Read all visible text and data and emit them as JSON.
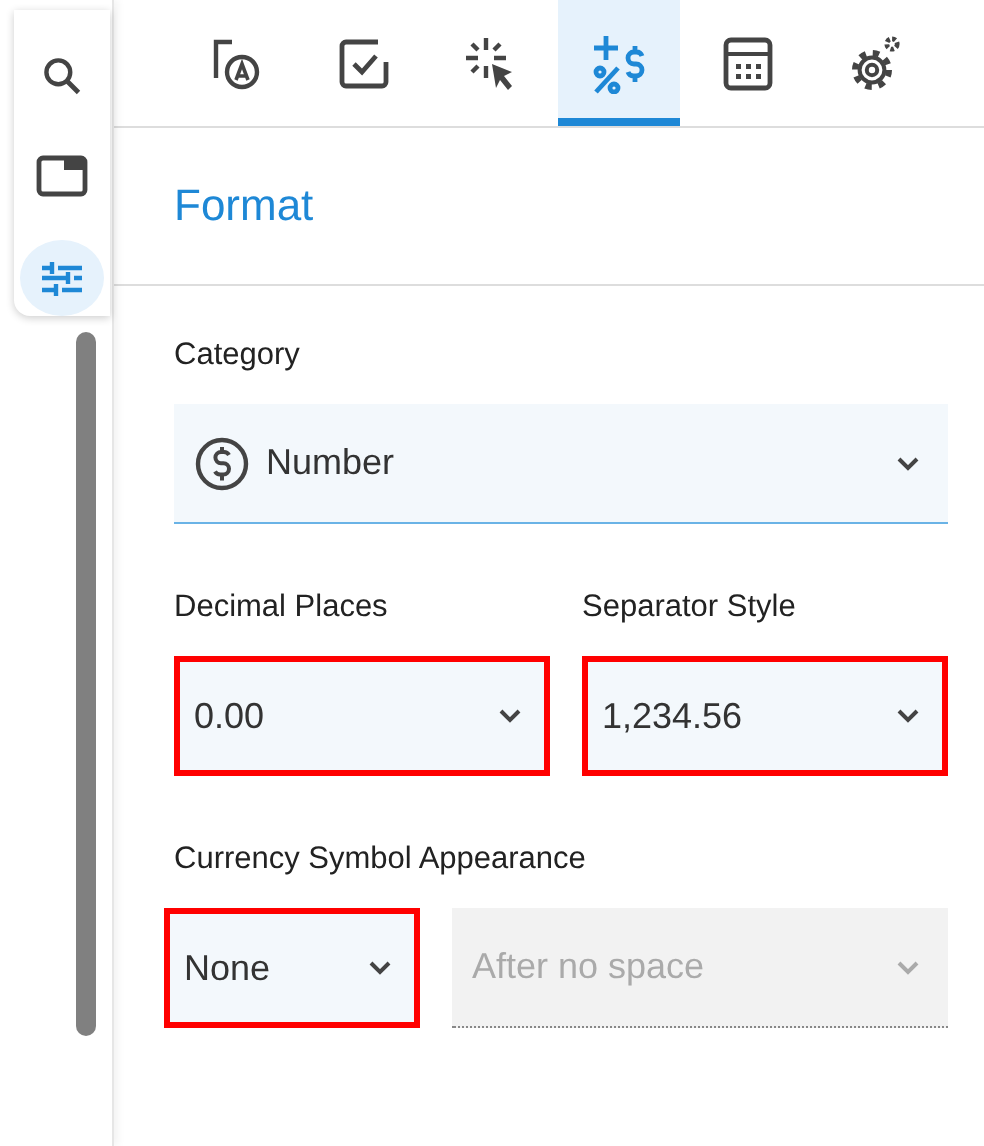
{
  "rail": [
    {
      "kind": "search",
      "selected": false
    },
    {
      "kind": "panel",
      "selected": false
    },
    {
      "kind": "sliders",
      "selected": true
    }
  ],
  "tabs": [
    {
      "kind": "text-style",
      "selected": false
    },
    {
      "kind": "checkbox",
      "selected": false
    },
    {
      "kind": "click",
      "selected": false
    },
    {
      "kind": "format",
      "selected": true
    },
    {
      "kind": "calculator",
      "selected": false
    },
    {
      "kind": "settings",
      "selected": false
    }
  ],
  "title": "Format",
  "category": {
    "label": "Category",
    "value": "Number"
  },
  "decimal_places": {
    "label": "Decimal Places",
    "value": "0.00",
    "highlighted": true
  },
  "separator_style": {
    "label": "Separator Style",
    "value": "1,234.56",
    "highlighted": true
  },
  "currency": {
    "label": "Currency Symbol Appearance",
    "symbol": {
      "value": "None",
      "highlighted": true,
      "disabled": false
    },
    "position": {
      "value": "After no space",
      "highlighted": false,
      "disabled": true
    }
  }
}
